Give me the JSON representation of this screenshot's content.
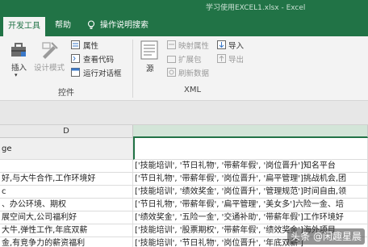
{
  "window": {
    "title": "学习使用EXCEL1.xlsx - Excel"
  },
  "tabs": [
    {
      "label": "开发工具",
      "active": true
    },
    {
      "label": "帮助",
      "active": false
    },
    {
      "label": "操作说明搜索",
      "active": false
    }
  ],
  "ribbon": {
    "controls_group": {
      "label": "控件",
      "insert": "插入",
      "design_mode": "设计模式",
      "properties": "属性",
      "view_code": "查看代码",
      "run_dialog": "运行对话框"
    },
    "xml_group": {
      "label": "XML",
      "source": "源",
      "map_properties": "映射属性",
      "expansion_packs": "扩展包",
      "refresh_data": "刷新数据",
      "import": "导入",
      "export": "导出"
    }
  },
  "columns": {
    "d": "D"
  },
  "rows": [
    {
      "left": "ge",
      "right": ""
    },
    {
      "left": "",
      "right": "['技能培训', '节日礼物', '带薪年假', '岗位晋升']知名平台"
    },
    {
      "left": "好,与大牛合作,工作环境好",
      "right": "['节日礼物', '带薪年假', '岗位晋升', '扁平管理']挑战机会,团"
    },
    {
      "left": "c",
      "right": "['技能培训', '绩效奖金', '岗位晋升', '管理规范']时间自由,领"
    },
    {
      "left": "、办公环境、期权",
      "right": "['节日礼物', '带薪年假', '扁平管理', '美女多']六险一金、培"
    },
    {
      "left": "展空间大,公司福利好",
      "right": "['绩效奖金', '五险一金', '交通补助', '带薪年假']工作环境好"
    },
    {
      "left": "大牛,弹性工作,年底双薪",
      "right": "['技能培训', '股票期权', '带薪年假', '绩效奖金']海外项目"
    },
    {
      "left": "金,有竞争力的薪资福利",
      "right": "['技能培训', '节日礼物', '岗位晋升', '年底双薪']"
    }
  ],
  "watermark": "头条 @闲趣星晨"
}
